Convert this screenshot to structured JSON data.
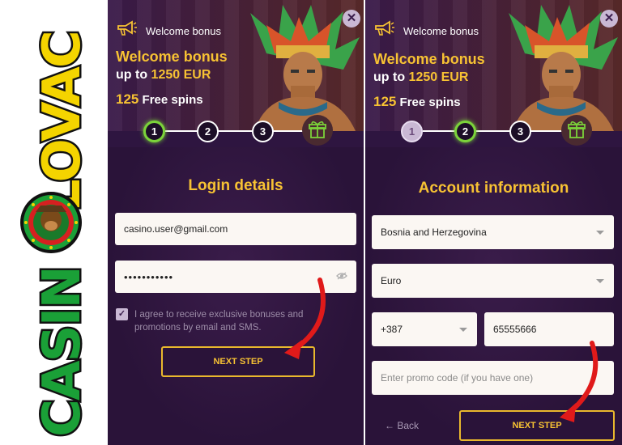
{
  "logo": {
    "text_word1": "CASINO",
    "text_word2": "LOVAC",
    "colors": {
      "green": "#1aa037",
      "yellow": "#f4d400",
      "red": "#d62020",
      "outline": "#111111"
    }
  },
  "icons": {
    "megaphone": "megaphone-icon",
    "close": "close-icon",
    "gift": "gift-icon",
    "eye": "eye-icon",
    "dropdown": "chevron-down-icon",
    "back": "arrow-left-icon"
  },
  "colors": {
    "panel_bg": "#2e1540",
    "accent_yellow": "#f7c233",
    "step_active_green": "#7bd33a",
    "arrow_red": "#e01a1a"
  },
  "panel1": {
    "banner": {
      "label": "Welcome bonus",
      "title": "Welcome bonus",
      "amount_prefix": "up to",
      "amount": "1250 EUR",
      "spins_count": "125",
      "spins_label": "Free spins",
      "close": "✕"
    },
    "steps": [
      {
        "label": "1",
        "state": "active"
      },
      {
        "label": "2",
        "state": "upcoming"
      },
      {
        "label": "3",
        "state": "upcoming"
      }
    ],
    "section_title": "Login details",
    "email_value": "casino.user@gmail.com",
    "password_value": "•••••••••••",
    "consent_check": "✓",
    "consent_line1": "I agree to receive exclusive bonuses and",
    "consent_line2": "promotions by email and SMS.",
    "next_label": "NEXT STEP"
  },
  "panel2": {
    "banner": {
      "label": "Welcome bonus",
      "title": "Welcome bonus",
      "amount_prefix": "up to",
      "amount": "1250 EUR",
      "spins_count": "125",
      "spins_label": "Free spins",
      "close": "✕"
    },
    "steps": [
      {
        "label": "1",
        "state": "done"
      },
      {
        "label": "2",
        "state": "active"
      },
      {
        "label": "3",
        "state": "upcoming"
      }
    ],
    "section_title": "Account information",
    "country_value": "Bosnia and Herzegovina",
    "currency_value": "Euro",
    "phone_code_value": "+387",
    "phone_value": "65555666",
    "promo_placeholder": "Enter promo code (if you have one)",
    "back_label": "Back",
    "back_arrow": "←",
    "next_label": "NEXT STEP"
  }
}
